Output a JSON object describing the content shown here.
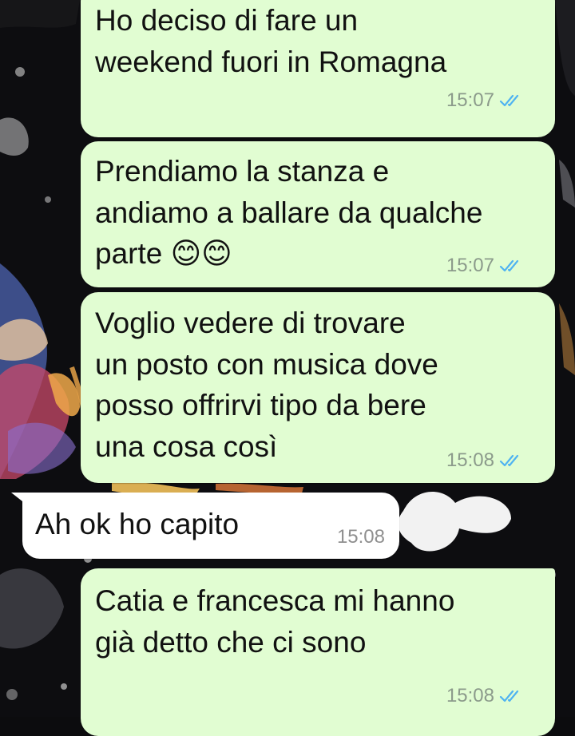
{
  "messages": [
    {
      "direction": "outgoing",
      "text": "Ho deciso di fare un\nweekend fuori in Romagna",
      "time": "15:07",
      "status": "read"
    },
    {
      "direction": "outgoing",
      "text": "Prendiamo la stanza e\nandiamo a ballare da qualche\nparte 😊😊",
      "time": "15:07",
      "status": "read"
    },
    {
      "direction": "outgoing",
      "text": "Voglio vedere di trovare\nun posto con musica dove\nposso offrirvi tipo da bere\nuna cosa così",
      "time": "15:08",
      "status": "read"
    },
    {
      "direction": "incoming",
      "text": "Ah ok ho capito",
      "time": "15:08"
    },
    {
      "direction": "outgoing",
      "text": "Catia e francesca mi hanno\ngià detto che ci sono",
      "time": "15:08",
      "status": "read"
    }
  ],
  "icons": {
    "read_receipt": "double-check-icon"
  },
  "colors": {
    "outgoing_bubble": "#e1fdd2",
    "incoming_bubble": "#ffffff",
    "read_tick": "#4fb3f1",
    "timestamp": "#8b9a8b"
  }
}
